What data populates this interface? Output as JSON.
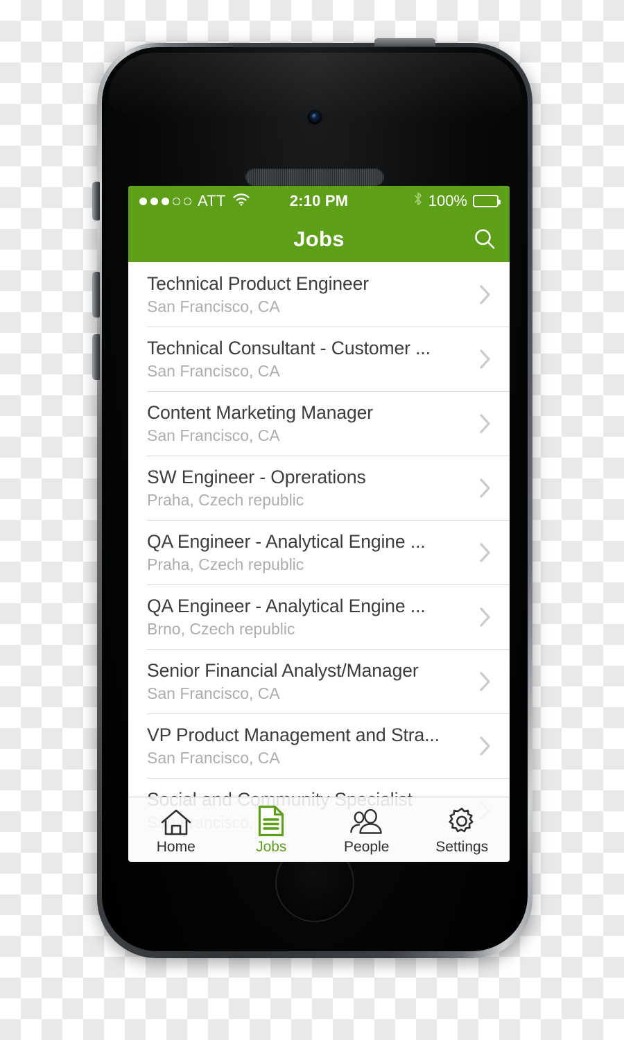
{
  "theme": {
    "brand_green": "#5da018",
    "title_text": "#3c3c3c",
    "subtitle_text": "#adadad",
    "separator": "#dcdcdc",
    "chevron": "#cccccc",
    "tabbar_bg": "#fafafa",
    "screen_bg": "#ffffff"
  },
  "statusbar": {
    "signal_dots_filled": 3,
    "signal_dots_total": 5,
    "carrier": "ATT",
    "wifi_icon": "wifi-icon",
    "time": "2:10 PM",
    "bluetooth_icon": "bluetooth-icon",
    "battery_percent": "100%",
    "battery_icon": "battery-full-icon"
  },
  "navbar": {
    "title": "Jobs",
    "search_icon": "search-icon"
  },
  "jobs": [
    {
      "title": "Technical Product Engineer",
      "location": "San Francisco, CA"
    },
    {
      "title": "Technical Consultant - Customer ...",
      "location": "San Francisco, CA"
    },
    {
      "title": "Content Marketing Manager",
      "location": "San Francisco, CA"
    },
    {
      "title": "SW Engineer - Oprerations",
      "location": "Praha, Czech republic"
    },
    {
      "title": "QA Engineer - Analytical Engine ...",
      "location": "Praha, Czech republic"
    },
    {
      "title": "QA Engineer - Analytical Engine ...",
      "location": "Brno, Czech republic"
    },
    {
      "title": "Senior Financial Analyst/Manager",
      "location": "San Francisco, CA"
    },
    {
      "title": "VP Product Management and Stra...",
      "location": "San Francisco, CA"
    },
    {
      "title": "Social and Community Specialist",
      "location": "San Francisco, CA"
    }
  ],
  "tabbar": {
    "active_index": 1,
    "tabs": [
      {
        "label": "Home",
        "icon": "home-icon"
      },
      {
        "label": "Jobs",
        "icon": "document-icon"
      },
      {
        "label": "People",
        "icon": "people-icon"
      },
      {
        "label": "Settings",
        "icon": "gear-icon"
      }
    ]
  }
}
